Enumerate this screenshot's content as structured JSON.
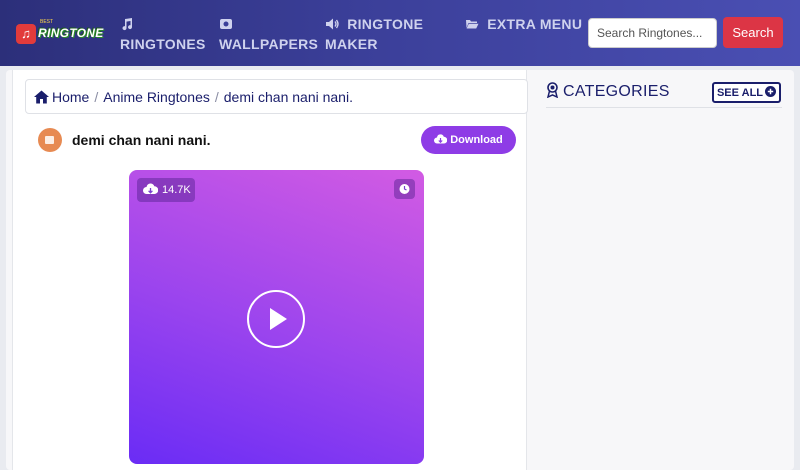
{
  "brand": {
    "name": "RINGTONE",
    "tagline": "BEST"
  },
  "nav": {
    "ringtones": "RINGTONES",
    "wallpapers": "WALLPAPERS",
    "maker_line1": "RINGTONE",
    "maker_line2": "MAKER",
    "extra": "EXTRA MENU"
  },
  "search": {
    "placeholder": "Search Ringtones...",
    "button": "Search"
  },
  "breadcrumb": {
    "home": "Home",
    "category": "Anime Ringtones",
    "current": "demi chan nani nani."
  },
  "ringtone": {
    "title": "demi chan nani nani.",
    "download_label": "Download",
    "download_count": "14.7K"
  },
  "sidebar": {
    "title": "CATEGORIES",
    "see_all": "SEE ALL"
  },
  "colors": {
    "nav_start": "#2c2f7a",
    "nav_end": "#4a4fb3",
    "search_button": "#dc3545",
    "download_button": "#8e3ce6",
    "player_start": "#6a2cf5",
    "player_end": "#d25be3"
  }
}
